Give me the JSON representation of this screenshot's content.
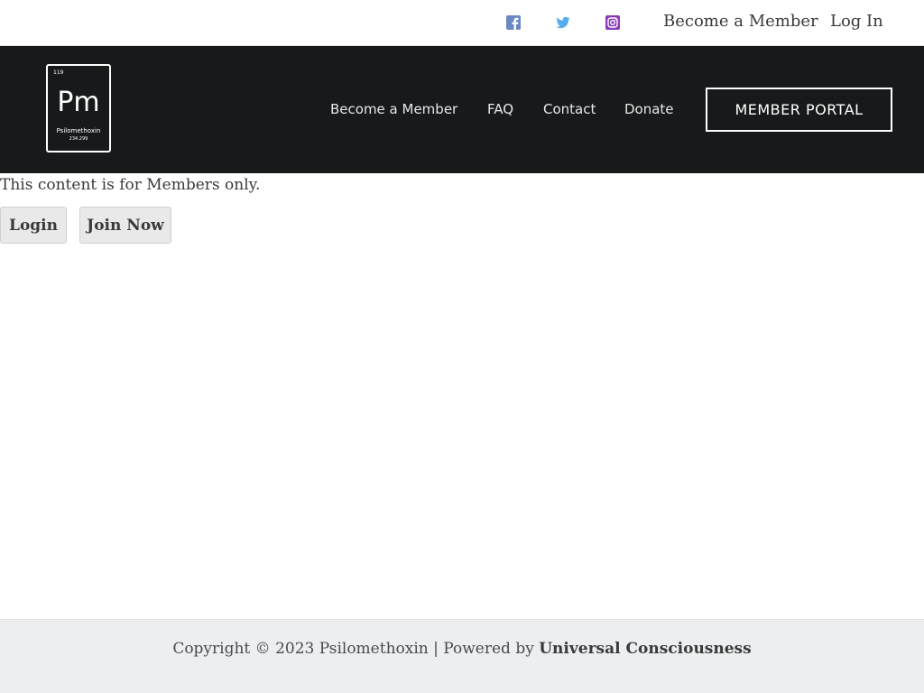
{
  "topbar": {
    "social": [
      {
        "icon": "facebook-icon",
        "color": "#6b88c4"
      },
      {
        "icon": "twitter-icon",
        "color": "#55acee"
      },
      {
        "icon": "instagram-icon",
        "color": "#8a3ab9"
      }
    ],
    "become_member": "Become a Member",
    "login": "Log In"
  },
  "header": {
    "logo": {
      "number": "119",
      "symbol": "Pm",
      "name": "Psilomethoxin",
      "mass": "234.299"
    },
    "nav": [
      "Become a Member",
      "FAQ",
      "Contact",
      "Donate"
    ],
    "portal_button": "MEMBER PORTAL",
    "background": "#17191b"
  },
  "content": {
    "message": "This content is for Members only.",
    "login_button": "Login",
    "join_button": "Join Now"
  },
  "footer": {
    "copyright": "Copyright © 2023 Psilomethoxin | Powered by ",
    "powered_by": "Universal Consciousness"
  }
}
